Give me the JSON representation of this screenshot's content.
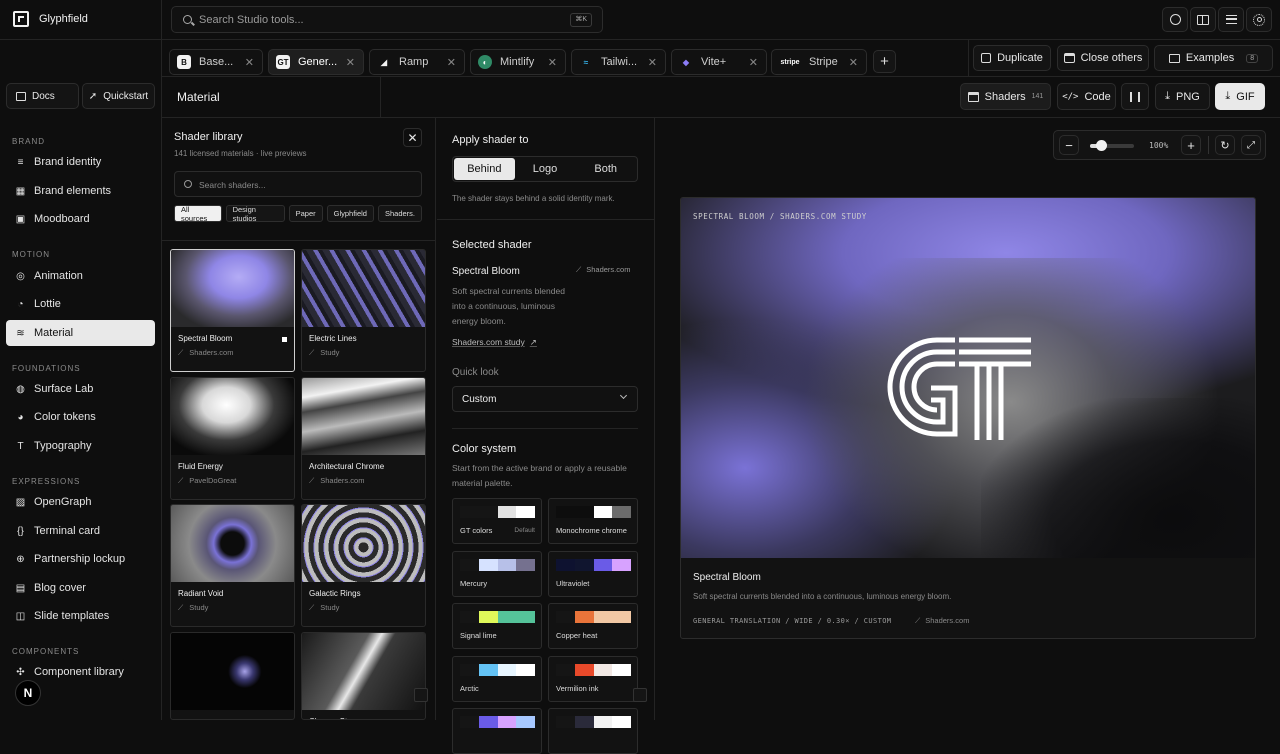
{
  "app": {
    "name": "Glyphfield"
  },
  "search": {
    "placeholder": "Search Studio tools...",
    "shortcut": "⌘K"
  },
  "tabs": [
    {
      "label": "Base...",
      "icon": "B",
      "active": false
    },
    {
      "label": "Gener...",
      "icon": "GT",
      "active": true
    },
    {
      "label": "Ramp",
      "icon": "ramp",
      "active": false
    },
    {
      "label": "Mintlify",
      "icon": "mint",
      "active": false
    },
    {
      "label": "Tailwi...",
      "icon": "tw",
      "active": false
    },
    {
      "label": "Vite+",
      "icon": "vite",
      "active": false
    },
    {
      "label": "Stripe",
      "icon": "stripe",
      "active": false
    }
  ],
  "tab_actions": {
    "duplicate": "Duplicate",
    "close_others": "Close others",
    "examples": "Examples",
    "examples_count": "8"
  },
  "sidebar": {
    "docs": "Docs",
    "quickstart": "Quickstart",
    "sections": [
      {
        "title": "BRAND",
        "items": [
          "Brand identity",
          "Brand elements",
          "Moodboard"
        ]
      },
      {
        "title": "MOTION",
        "items": [
          "Animation",
          "Lottie",
          "Material"
        ]
      },
      {
        "title": "FOUNDATIONS",
        "items": [
          "Surface Lab",
          "Color tokens",
          "Typography"
        ]
      },
      {
        "title": "EXPRESSIONS",
        "items": [
          "OpenGraph",
          "Terminal card",
          "Partnership lockup",
          "Blog cover",
          "Slide templates"
        ]
      },
      {
        "title": "COMPONENTS",
        "items": [
          "Component library"
        ]
      }
    ],
    "avatar": "N"
  },
  "header": {
    "title": "Material",
    "shaders_label": "Shaders",
    "shaders_count": "141",
    "code": "Code",
    "png": "PNG",
    "gif": "GIF"
  },
  "library": {
    "title": "Shader library",
    "subtitle": "141 licensed materials · live previews",
    "placeholder": "Search shaders...",
    "filters": [
      "All sources",
      "Design studios",
      "Paper",
      "Glyphfield",
      "Shaders."
    ],
    "cards": [
      {
        "name": "Spectral Bloom",
        "source": "Shaders.com"
      },
      {
        "name": "Electric Lines",
        "source": "Study"
      },
      {
        "name": "Fluid Energy",
        "source": "PavelDoGreat"
      },
      {
        "name": "Architectural Chrome",
        "source": "Shaders.com"
      },
      {
        "name": "Radiant Void",
        "source": "Study"
      },
      {
        "name": "Galactic Rings",
        "source": "Study"
      },
      {
        "name": "",
        "source": ""
      },
      {
        "name": "Chrome St...",
        "source": ""
      }
    ]
  },
  "settings": {
    "apply_title": "Apply shader to",
    "apply_options": [
      "Behind",
      "Logo",
      "Both"
    ],
    "apply_note": "The shader stays behind a solid identity mark.",
    "selected_title": "Selected shader",
    "shader_name": "Spectral Bloom",
    "shader_source": "Shaders.com",
    "shader_desc": "Soft spectral currents blended into a continuous, luminous energy bloom.",
    "study_link": "Shaders.com study",
    "quick_look_label": "Quick look",
    "quick_look_value": "Custom",
    "color_title": "Color system",
    "color_desc": "Start from the active brand or apply a reusable material palette.",
    "palettes": [
      {
        "name": "GT colors",
        "tag": "Default",
        "colors": [
          "#151515",
          "#151515",
          "#e2e2e2",
          "#ffffff"
        ]
      },
      {
        "name": "Monochrome chrome",
        "tag": "",
        "colors": [
          "#0d0d0d",
          "#0d0d0d",
          "#ffffff",
          "#6b6b6b"
        ]
      },
      {
        "name": "Mercury",
        "tag": "",
        "colors": [
          "#151515",
          "#d6e2ff",
          "#b7c0e8",
          "#75718f"
        ]
      },
      {
        "name": "Ultraviolet",
        "tag": "",
        "colors": [
          "#0e1230",
          "#10152f",
          "#6a5be7",
          "#d7a2ff"
        ]
      },
      {
        "name": "Signal lime",
        "tag": "",
        "colors": [
          "#151515",
          "#e0f95a",
          "#55c39a",
          "#55c39a"
        ]
      },
      {
        "name": "Copper heat",
        "tag": "",
        "colors": [
          "#151515",
          "#e9743a",
          "#f2c8a4",
          "#f2c8a4"
        ]
      },
      {
        "name": "Arctic",
        "tag": "",
        "colors": [
          "#151515",
          "#64c3f5",
          "#e7f5ff",
          "#ffffff"
        ]
      },
      {
        "name": "Vermilion ink",
        "tag": "",
        "colors": [
          "#151515",
          "#e8492a",
          "#f2e8e4",
          "#ffffff"
        ]
      },
      {
        "name": "",
        "tag": "",
        "colors": [
          "#151515",
          "#6a5be7",
          "#d7a2ff",
          "#a7c8ff"
        ]
      },
      {
        "name": "",
        "tag": "",
        "colors": [
          "#151515",
          "#2a2a3a",
          "#f2f2f2",
          "#ffffff"
        ]
      }
    ]
  },
  "preview": {
    "zoom": "100%",
    "zoom_level": 0.25,
    "overlay_caption": "SPECTRAL BLOOM / SHADERS.COM STUDY",
    "title": "Spectral Bloom",
    "desc": "Soft spectral currents blended into a continuous, luminous energy bloom.",
    "meta": "GENERAL TRANSLATION / WIDE / 0.30× / CUSTOM",
    "meta_source": "Shaders.com"
  },
  "colors": {
    "accent": "#8f86e6",
    "bg": "#0e0e0e"
  }
}
